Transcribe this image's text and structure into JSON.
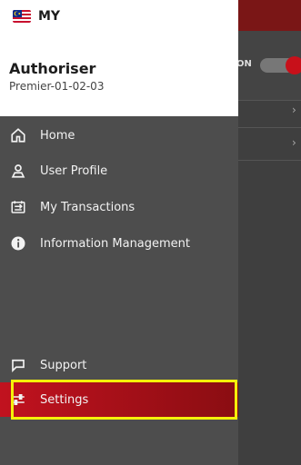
{
  "drawer": {
    "country": {
      "code": "MY",
      "flag": "malaysia-flag-icon"
    },
    "user": {
      "name": "Authoriser",
      "role": "Premier-01-02-03"
    },
    "menu": [
      {
        "label": "Home",
        "icon": "home-icon"
      },
      {
        "label": "User Profile",
        "icon": "user-icon"
      },
      {
        "label": "My Transactions",
        "icon": "transactions-icon"
      },
      {
        "label": "Information Management",
        "icon": "info-icon"
      }
    ],
    "footer_menu": [
      {
        "label": "Support",
        "icon": "chat-icon"
      },
      {
        "label": "Settings",
        "icon": "settings-sliders-icon",
        "selected": true
      }
    ]
  },
  "background": {
    "toggle_label": "ON"
  },
  "colors": {
    "brand_red": "#c1121f",
    "drawer_bg": "#4d4d4d",
    "highlight": "#f4f10a"
  }
}
